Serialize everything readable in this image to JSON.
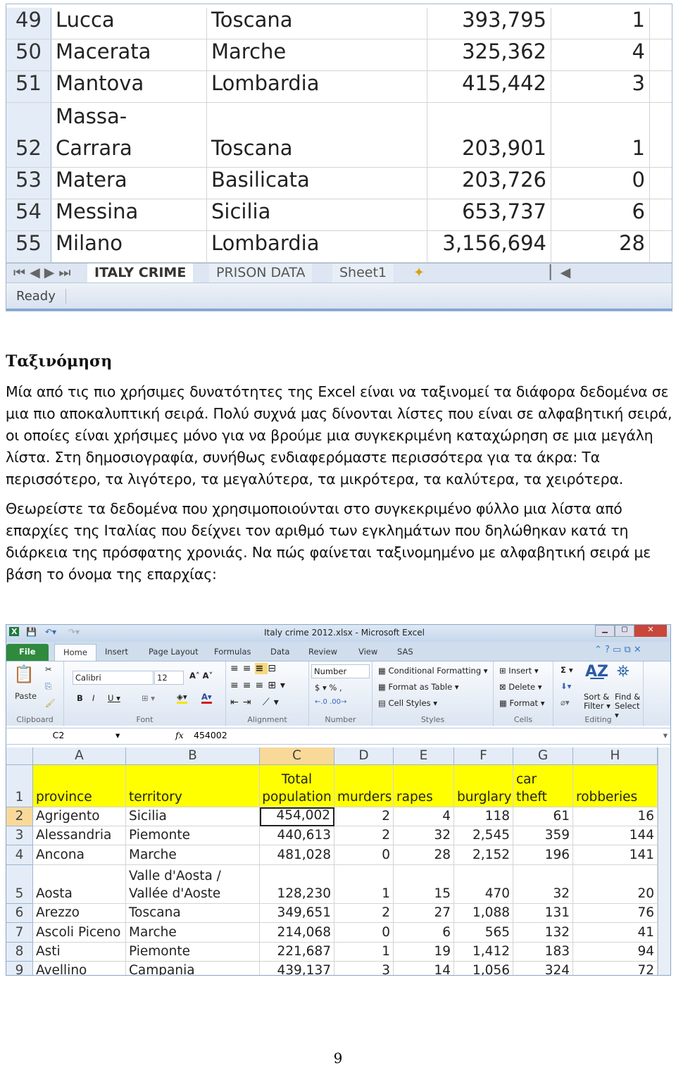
{
  "top_sheet": {
    "rows": [
      {
        "n": "49",
        "province": "Lucca",
        "territory": "Toscana",
        "population": "393,795",
        "murders": "1"
      },
      {
        "n": "50",
        "province": "Macerata",
        "territory": "Marche",
        "population": "325,362",
        "murders": "4"
      },
      {
        "n": "51",
        "province": "Mantova",
        "territory": "Lombardia",
        "population": "415,442",
        "murders": "3"
      },
      {
        "n": "52",
        "province": "Massa-\nCarrara",
        "territory": "Toscana",
        "population": "203,901",
        "murders": "1"
      },
      {
        "n": "53",
        "province": "Matera",
        "territory": "Basilicata",
        "population": "203,726",
        "murders": "0"
      },
      {
        "n": "54",
        "province": "Messina",
        "territory": "Sicilia",
        "population": "653,737",
        "murders": "6"
      },
      {
        "n": "55",
        "province": "Milano",
        "territory": "Lombardia",
        "population": "3,156,694",
        "murders": "28"
      }
    ],
    "tabs": [
      "ITALY CRIME",
      "PRISON DATA",
      "Sheet1"
    ],
    "active_tab": "ITALY CRIME",
    "status": "Ready"
  },
  "heading": "Ταξινόμηση",
  "paragraph1": "Μία από τις πιο χρήσιμες δυνατότητες της Excel είναι να ταξινομεί τα διάφορα δεδομένα σε μια πιο αποκαλυπτική σειρά. Πολύ συχνά μας δίνονται λίστες που είναι σε αλφαβητική σειρά, οι οποίες είναι χρήσιμες μόνο για να βρούμε μια συγκεκριμένη καταχώρηση σε μια μεγάλη λίστα. Στη δημοσιογραφία, συνήθως ενδιαφερόμαστε περισσότερα για τα άκρα: Τα περισσότερο, τα λιγότερο, τα μεγαλύτερα,  τα μικρότερα, τα καλύτερα, τα χειρότερα.",
  "paragraph2": "Θεωρείστε τα δεδομένα που χρησιμοποιούνται στο συγκεκριμένο φύλλο μια λίστα από επαρχίες της Ιταλίας που δείχνει τον αριθμό των εγκλημάτων που δηλώθηκαν κατά τη διάρκεια της πρόσφατης χρονιάς. Να πώς φαίνεται ταξινομημένο με αλφαβητική σειρά με βάση το όνομα της επαρχίας:",
  "excel": {
    "title": "Italy crime 2012.xlsx - Microsoft Excel",
    "ribbon_tabs": [
      "File",
      "Home",
      "Insert",
      "Page Layout",
      "Formulas",
      "Data",
      "Review",
      "View",
      "SAS"
    ],
    "active_ribbon_tab": "Home",
    "font_name": "Calibri",
    "font_size": "12",
    "number_format": "Number",
    "paste": "Paste",
    "groups": {
      "clipboard": "Clipboard",
      "font": "Font",
      "alignment": "Alignment",
      "number": "Number",
      "styles": "Styles",
      "cells": "Cells",
      "editing": "Editing"
    },
    "styles": [
      "Conditional Formatting ▾",
      "Format as Table ▾",
      "Cell Styles ▾"
    ],
    "cells": [
      "Insert ▾",
      "Delete ▾",
      "Format ▾"
    ],
    "sort_filter": "Sort &\nFilter ▾",
    "find_select": "Find &\nSelect ▾",
    "name_box": "C2",
    "formula": "454002",
    "fx": "fx",
    "columns": [
      "A",
      "B",
      "C",
      "D",
      "E",
      "F",
      "G",
      "H"
    ],
    "header_row": [
      "province",
      "territory",
      "Total\npopulation",
      "murders",
      "rapes",
      "burglary",
      "car theft",
      "robberies"
    ],
    "rows": [
      [
        "2",
        "Agrigento",
        "Sicilia",
        "454,002",
        "2",
        "4",
        "118",
        "61",
        "16"
      ],
      [
        "3",
        "Alessandria",
        "Piemonte",
        "440,613",
        "2",
        "32",
        "2,545",
        "359",
        "144"
      ],
      [
        "4",
        "Ancona",
        "Marche",
        "481,028",
        "0",
        "28",
        "2,152",
        "196",
        "141"
      ],
      [
        "5",
        "Aosta",
        "Valle d'Aosta /\nVallée d'Aoste",
        "128,230",
        "1",
        "15",
        "470",
        "32",
        "20"
      ],
      [
        "6",
        "Arezzo",
        "Toscana",
        "349,651",
        "2",
        "27",
        "1,088",
        "131",
        "76"
      ],
      [
        "7",
        "Ascoli Piceno",
        "Marche",
        "214,068",
        "0",
        "6",
        "565",
        "132",
        "41"
      ],
      [
        "8",
        "Asti",
        "Piemonte",
        "221,687",
        "1",
        "19",
        "1,412",
        "183",
        "94"
      ],
      [
        "9",
        "Avellino",
        "Campania",
        "439,137",
        "3",
        "14",
        "1,056",
        "324",
        "72"
      ]
    ],
    "header_fill": "#ffff00"
  },
  "page_number": "9"
}
